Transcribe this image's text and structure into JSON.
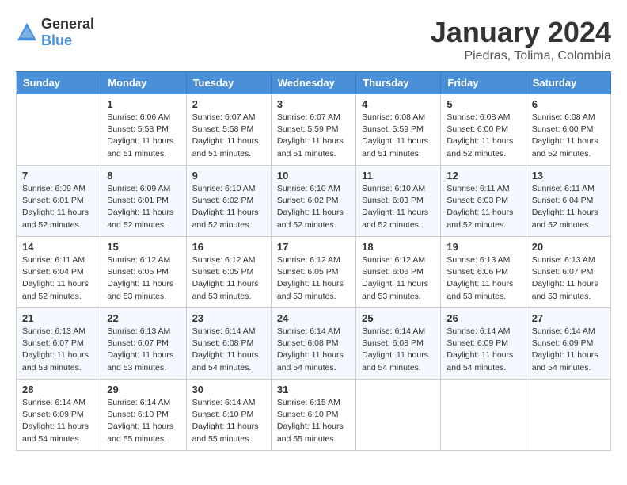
{
  "header": {
    "logo_general": "General",
    "logo_blue": "Blue",
    "title": "January 2024",
    "location": "Piedras, Tolima, Colombia"
  },
  "days_of_week": [
    "Sunday",
    "Monday",
    "Tuesday",
    "Wednesday",
    "Thursday",
    "Friday",
    "Saturday"
  ],
  "weeks": [
    [
      {
        "day": "",
        "sunrise": "",
        "sunset": "",
        "daylight": ""
      },
      {
        "day": "1",
        "sunrise": "6:06 AM",
        "sunset": "5:58 PM",
        "daylight": "11 hours and 51 minutes."
      },
      {
        "day": "2",
        "sunrise": "6:07 AM",
        "sunset": "5:58 PM",
        "daylight": "11 hours and 51 minutes."
      },
      {
        "day": "3",
        "sunrise": "6:07 AM",
        "sunset": "5:59 PM",
        "daylight": "11 hours and 51 minutes."
      },
      {
        "day": "4",
        "sunrise": "6:08 AM",
        "sunset": "5:59 PM",
        "daylight": "11 hours and 51 minutes."
      },
      {
        "day": "5",
        "sunrise": "6:08 AM",
        "sunset": "6:00 PM",
        "daylight": "11 hours and 52 minutes."
      },
      {
        "day": "6",
        "sunrise": "6:08 AM",
        "sunset": "6:00 PM",
        "daylight": "11 hours and 52 minutes."
      }
    ],
    [
      {
        "day": "7",
        "sunrise": "6:09 AM",
        "sunset": "6:01 PM",
        "daylight": "11 hours and 52 minutes."
      },
      {
        "day": "8",
        "sunrise": "6:09 AM",
        "sunset": "6:01 PM",
        "daylight": "11 hours and 52 minutes."
      },
      {
        "day": "9",
        "sunrise": "6:10 AM",
        "sunset": "6:02 PM",
        "daylight": "11 hours and 52 minutes."
      },
      {
        "day": "10",
        "sunrise": "6:10 AM",
        "sunset": "6:02 PM",
        "daylight": "11 hours and 52 minutes."
      },
      {
        "day": "11",
        "sunrise": "6:10 AM",
        "sunset": "6:03 PM",
        "daylight": "11 hours and 52 minutes."
      },
      {
        "day": "12",
        "sunrise": "6:11 AM",
        "sunset": "6:03 PM",
        "daylight": "11 hours and 52 minutes."
      },
      {
        "day": "13",
        "sunrise": "6:11 AM",
        "sunset": "6:04 PM",
        "daylight": "11 hours and 52 minutes."
      }
    ],
    [
      {
        "day": "14",
        "sunrise": "6:11 AM",
        "sunset": "6:04 PM",
        "daylight": "11 hours and 52 minutes."
      },
      {
        "day": "15",
        "sunrise": "6:12 AM",
        "sunset": "6:05 PM",
        "daylight": "11 hours and 53 minutes."
      },
      {
        "day": "16",
        "sunrise": "6:12 AM",
        "sunset": "6:05 PM",
        "daylight": "11 hours and 53 minutes."
      },
      {
        "day": "17",
        "sunrise": "6:12 AM",
        "sunset": "6:05 PM",
        "daylight": "11 hours and 53 minutes."
      },
      {
        "day": "18",
        "sunrise": "6:12 AM",
        "sunset": "6:06 PM",
        "daylight": "11 hours and 53 minutes."
      },
      {
        "day": "19",
        "sunrise": "6:13 AM",
        "sunset": "6:06 PM",
        "daylight": "11 hours and 53 minutes."
      },
      {
        "day": "20",
        "sunrise": "6:13 AM",
        "sunset": "6:07 PM",
        "daylight": "11 hours and 53 minutes."
      }
    ],
    [
      {
        "day": "21",
        "sunrise": "6:13 AM",
        "sunset": "6:07 PM",
        "daylight": "11 hours and 53 minutes."
      },
      {
        "day": "22",
        "sunrise": "6:13 AM",
        "sunset": "6:07 PM",
        "daylight": "11 hours and 53 minutes."
      },
      {
        "day": "23",
        "sunrise": "6:14 AM",
        "sunset": "6:08 PM",
        "daylight": "11 hours and 54 minutes."
      },
      {
        "day": "24",
        "sunrise": "6:14 AM",
        "sunset": "6:08 PM",
        "daylight": "11 hours and 54 minutes."
      },
      {
        "day": "25",
        "sunrise": "6:14 AM",
        "sunset": "6:08 PM",
        "daylight": "11 hours and 54 minutes."
      },
      {
        "day": "26",
        "sunrise": "6:14 AM",
        "sunset": "6:09 PM",
        "daylight": "11 hours and 54 minutes."
      },
      {
        "day": "27",
        "sunrise": "6:14 AM",
        "sunset": "6:09 PM",
        "daylight": "11 hours and 54 minutes."
      }
    ],
    [
      {
        "day": "28",
        "sunrise": "6:14 AM",
        "sunset": "6:09 PM",
        "daylight": "11 hours and 54 minutes."
      },
      {
        "day": "29",
        "sunrise": "6:14 AM",
        "sunset": "6:10 PM",
        "daylight": "11 hours and 55 minutes."
      },
      {
        "day": "30",
        "sunrise": "6:14 AM",
        "sunset": "6:10 PM",
        "daylight": "11 hours and 55 minutes."
      },
      {
        "day": "31",
        "sunrise": "6:15 AM",
        "sunset": "6:10 PM",
        "daylight": "11 hours and 55 minutes."
      },
      {
        "day": "",
        "sunrise": "",
        "sunset": "",
        "daylight": ""
      },
      {
        "day": "",
        "sunrise": "",
        "sunset": "",
        "daylight": ""
      },
      {
        "day": "",
        "sunrise": "",
        "sunset": "",
        "daylight": ""
      }
    ]
  ],
  "labels": {
    "sunrise_prefix": "Sunrise: ",
    "sunset_prefix": "Sunset: ",
    "daylight_prefix": "Daylight: "
  }
}
